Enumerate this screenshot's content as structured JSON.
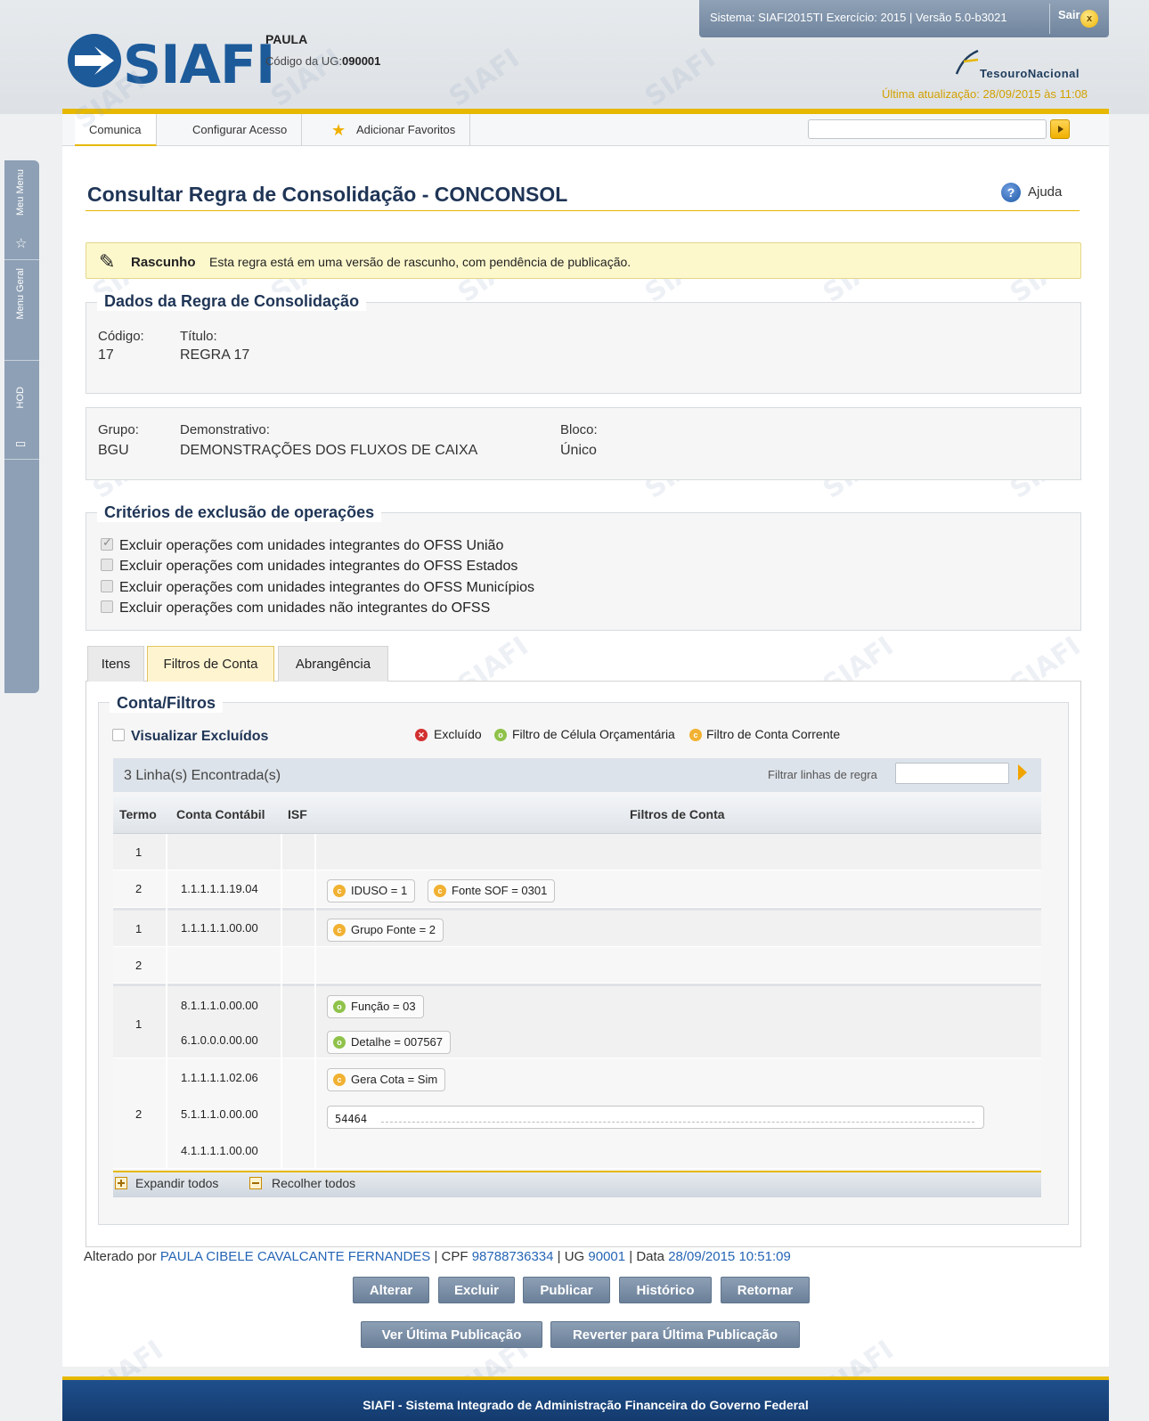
{
  "header": {
    "system_info": "Sistema: SIAFI2015TI Exercício: 2015 | Versão 5.0-b3021",
    "logout_label": "Sair",
    "logout_icon": "x",
    "logo_text": "SIAFI",
    "user_name": "PAULA",
    "ug_label": "Código da UG:",
    "ug_code": "090001",
    "tesouro_label": "TesouroNacional",
    "last_update": "Última atualização: 28/09/2015 às 11:08"
  },
  "nav": {
    "tabs": [
      "Comunica",
      "Configurar Acesso",
      "Adicionar Favoritos"
    ]
  },
  "side_tabs": [
    "Meu Menu",
    "Menu Geral",
    "HOD"
  ],
  "page": {
    "title": "Consultar Regra de Consolidação - CONCONSOL",
    "help_label": "Ajuda",
    "draft_title": "Rascunho",
    "draft_message": "Esta regra está em uma versão de rascunho, com pendência de publicação."
  },
  "dados": {
    "legend": "Dados da Regra de Consolidação",
    "codigo_label": "Código:",
    "codigo": "17",
    "titulo_label": "Título:",
    "titulo": "REGRA 17",
    "grupo_label": "Grupo:",
    "grupo": "BGU",
    "demonstrativo_label": "Demonstrativo:",
    "demonstrativo": "DEMONSTRAÇÕES DOS FLUXOS DE CAIXA",
    "bloco_label": "Bloco:",
    "bloco": "Único"
  },
  "criterios": {
    "legend": "Critérios de exclusão de operações",
    "items": [
      {
        "label": "Excluir operações com unidades integrantes do OFSS União",
        "checked": true
      },
      {
        "label": "Excluir operações com unidades integrantes do OFSS Estados",
        "checked": false
      },
      {
        "label": "Excluir operações com unidades integrantes do OFSS Municípios",
        "checked": false
      },
      {
        "label": "Excluir operações com unidades não integrantes do OFSS",
        "checked": false
      }
    ]
  },
  "tabs": [
    "Itens",
    "Filtros de Conta",
    "Abrangência"
  ],
  "conta_filtros": {
    "legend": "Conta/Filtros",
    "show_excluded_label": "Visualizar Excluídos",
    "legend_items": [
      "Excluído",
      "Filtro de Célula Orçamentária",
      "Filtro de Conta Corrente"
    ],
    "count_text": "3 Linha(s) Encontrada(s)",
    "filter_label": "Filtrar linhas de regra",
    "columns": [
      "Termo",
      "Conta Contábil",
      "ISF",
      "Filtros de Conta"
    ],
    "rows": [
      {
        "termo": "1",
        "conta": "",
        "filters": []
      },
      {
        "termo": "2",
        "conta": "1.1.1.1.1.19.04",
        "filters": [
          "IDUSO = 1",
          "Fonte SOF = 0301"
        ]
      },
      {
        "termo": "1",
        "conta": "1.1.1.1.1.00.00",
        "filters": [
          "Grupo Fonte = 2"
        ]
      },
      {
        "termo": "2",
        "conta": "",
        "filters": []
      },
      {
        "termo": "1",
        "conta": "8.1.1.1.0.00.00",
        "filters": [
          "Função = 03"
        ]
      },
      {
        "termo": "",
        "conta": "6.1.0.0.0.00.00",
        "filters": [
          "Detalhe = 007567"
        ]
      },
      {
        "termo": "",
        "conta": "1.1.1.1.1.02.06",
        "filters": [
          "Gera Cota = Sim"
        ]
      },
      {
        "termo": "2",
        "conta": "5.1.1.1.0.00.00",
        "filters": [
          "54464"
        ]
      },
      {
        "termo": "",
        "conta": "4.1.1.1.1.00.00",
        "filters": []
      }
    ],
    "expand_label": "Expandir todos",
    "collapse_label": "Recolher todos"
  },
  "audit": {
    "prefix": "Alterado por",
    "user": "PAULA CIBELE CAVALCANTE FERNANDES",
    "cpf_label": "CPF",
    "cpf": "98788736334",
    "ug_label": "UG",
    "ug": "90001",
    "data_label": "Data",
    "data": "28/09/2015 10:51:09"
  },
  "actions": {
    "row1": [
      "Alterar",
      "Excluir",
      "Publicar",
      "Histórico",
      "Retornar"
    ],
    "row2": [
      "Ver Última Publicação",
      "Reverter para Última Publicação"
    ]
  },
  "footer": {
    "text": "SIAFI - Sistema Integrado de Administração Financeira do Governo Federal"
  },
  "colors": {
    "accent_yellow": "#e6b800",
    "title_blue": "#1f3556",
    "button_gray": "#7a8ea5",
    "excluded_red": "#d23030",
    "celula_green": "#8fc24a",
    "conta_corrente_orange": "#f1b132"
  }
}
